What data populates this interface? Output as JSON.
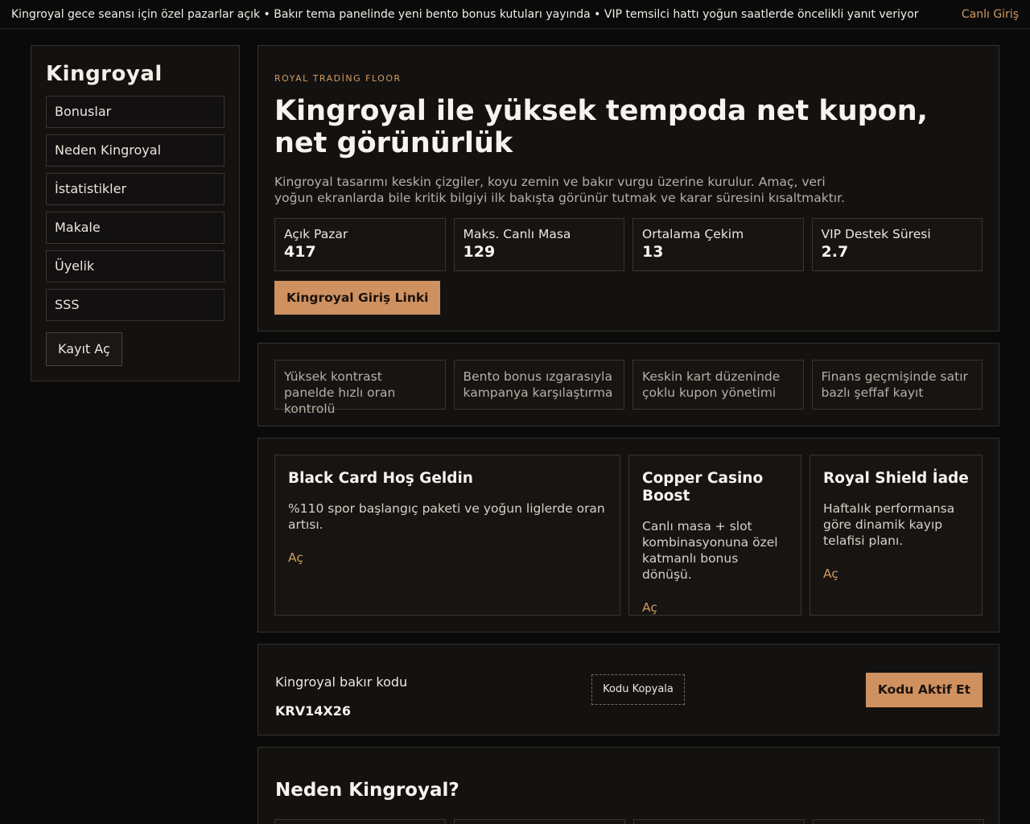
{
  "ticker": {
    "text": "Kingroyal gece seansı için özel pazarlar açık • Bakır tema panelinde yeni bento bonus kutuları yayında • VIP temsilci hattı yoğun saatlerde öncelikli yanıt veriyor",
    "login_label": "Canlı Giriş"
  },
  "sidebar": {
    "logo": "Kingroyal",
    "items": [
      {
        "label": "Bonuslar"
      },
      {
        "label": "Neden Kingroyal"
      },
      {
        "label": "İstatistikler"
      },
      {
        "label": "Makale"
      },
      {
        "label": "Üyelik"
      },
      {
        "label": "SSS"
      }
    ],
    "register_label": "Kayıt Aç"
  },
  "hero": {
    "eyebrow": "ROYAL TRADİNG FLOOR",
    "title": "Kingroyal ile yüksek tempoda net kupon, net görünürlük",
    "description": "Kingroyal tasarımı keskin çizgiler, koyu zemin ve bakır vurgu üzerine kurulur. Amaç, veri yoğun ekranlarda bile kritik bilgiyi ilk bakışta görünür tutmak ve karar süresini kısaltmaktır.",
    "stats": [
      {
        "label": "Açık Pazar",
        "value": "417"
      },
      {
        "label": "Maks. Canlı Masa",
        "value": "129"
      },
      {
        "label": "Ortalama Çekim",
        "value": "13"
      },
      {
        "label": "VIP Destek Süresi",
        "value": "2.7"
      }
    ],
    "cta_label": "Kingroyal Giriş Linki"
  },
  "features": [
    {
      "text": "Yüksek kontrast panelde hızlı oran kontrolü"
    },
    {
      "text": "Bento bonus ızgarasıyla kampanya karşılaştırma"
    },
    {
      "text": "Keskin kart düzeninde çoklu kupon yönetimi"
    },
    {
      "text": "Finans geçmişinde satır bazlı şeffaf kayıt"
    }
  ],
  "bonuses": [
    {
      "title": "Black Card Hoş Geldin",
      "description": "%110 spor başlangıç paketi ve yoğun liglerde oran artısı.",
      "link": "Aç"
    },
    {
      "title": "Copper Casino Boost",
      "description": "Canlı masa + slot kombinasyonuna özel katmanlı bonus dönüşü.",
      "link": "Aç"
    },
    {
      "title": "Royal Shield İade",
      "description": "Haftalık performansa göre dinamik kayıp telafisi planı.",
      "link": "Aç"
    }
  ],
  "code": {
    "label": "Kingroyal bakır kodu",
    "value": "KRV14X26",
    "copy_label": "Kodu Kopyala",
    "activate_label": "Kodu Aktif Et"
  },
  "why": {
    "title": "Neden Kingroyal?"
  },
  "colors": {
    "accent": "#d09160",
    "background": "#0a0a0a",
    "panel": "#141210"
  }
}
